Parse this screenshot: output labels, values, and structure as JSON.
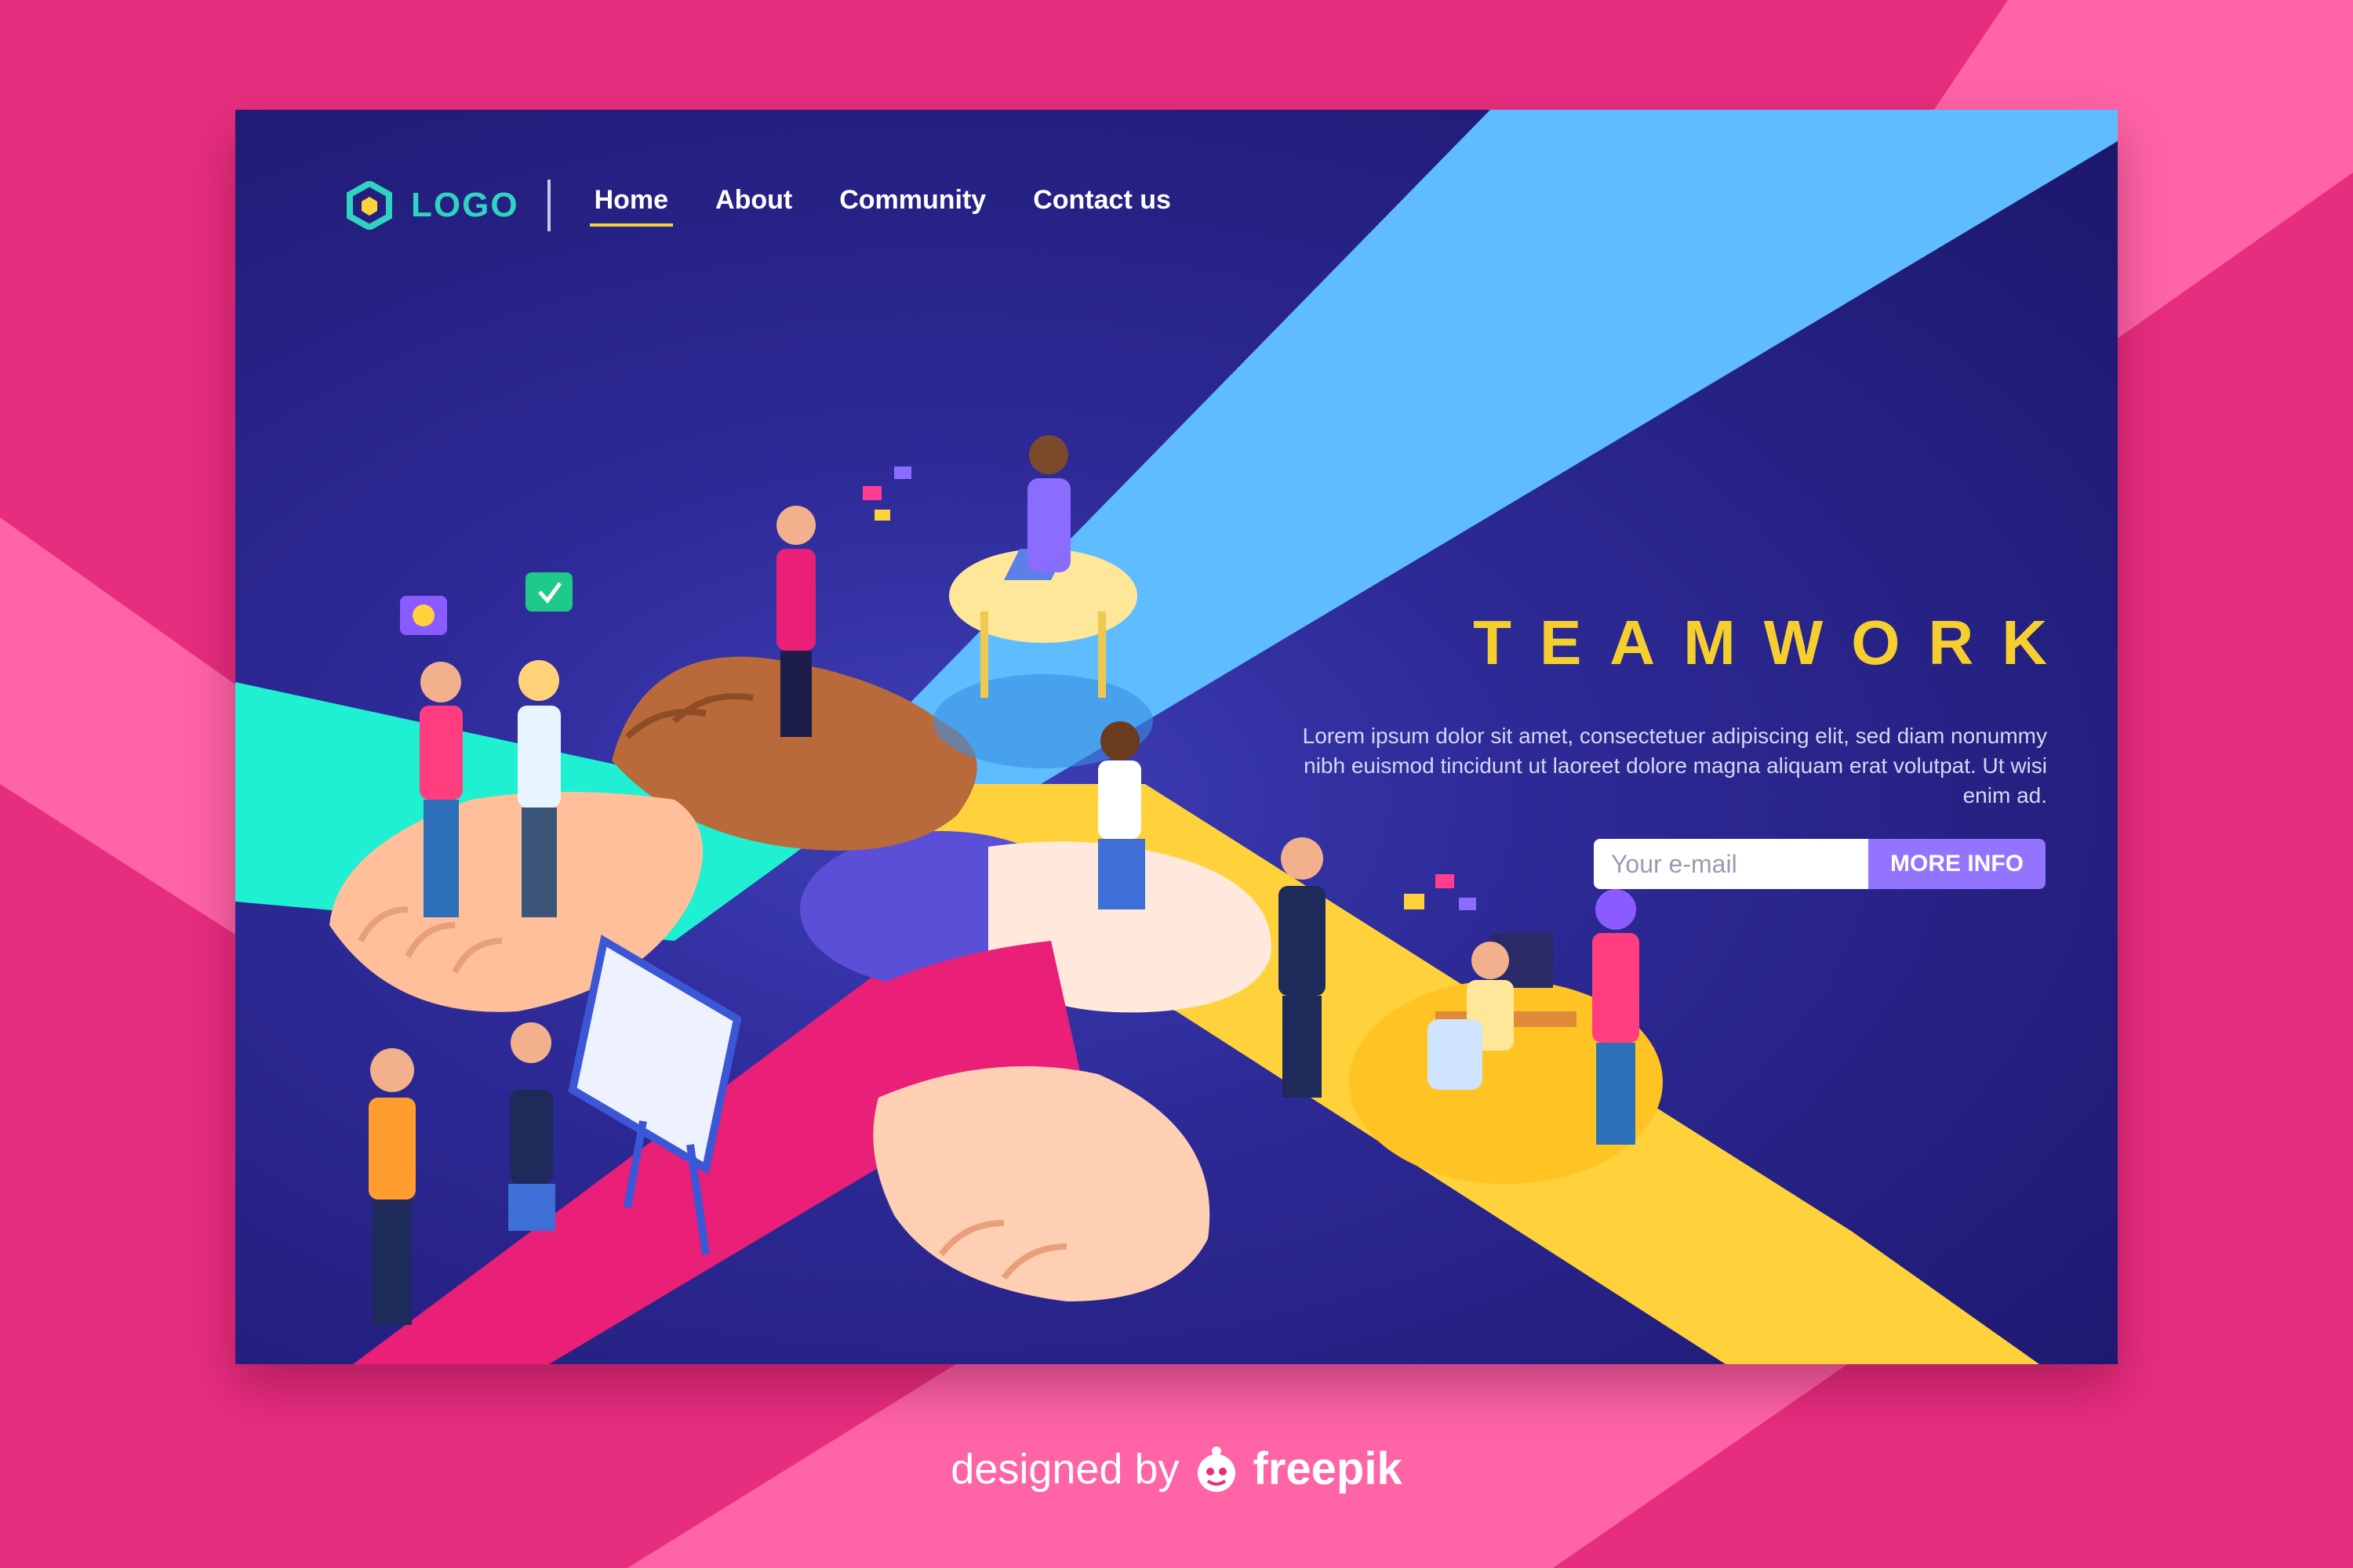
{
  "nav": {
    "logo_label": "LOGO",
    "links": [
      {
        "label": "Home",
        "active": true
      },
      {
        "label": "About",
        "active": false
      },
      {
        "label": "Community",
        "active": false
      },
      {
        "label": "Contact us",
        "active": false
      }
    ]
  },
  "hero": {
    "title": "TEAMWORK",
    "description": "Lorem ipsum dolor sit amet, consectetuer adipiscing elit, sed diam nonummy nibh euismod tincidunt ut laoreet dolore magna aliquam erat volutpat. Ut wisi enim ad."
  },
  "subscribe": {
    "email_placeholder": "Your e-mail",
    "button_label": "MORE INFO"
  },
  "footer": {
    "credit_text": "designed by",
    "brand": "freepik"
  },
  "colors": {
    "background_pink": "#e72d7e",
    "stripe_pink": "#ff64a6",
    "card_navy": "#1c166a",
    "logo_teal": "#2fd3c0",
    "title_yellow": "#f6cf2e",
    "button_purple": "#9274ff",
    "band_blue": "#5ebcff",
    "band_teal": "#1ef0d1",
    "band_yellow": "#ffd23b",
    "band_pink": "#e91f78"
  },
  "icons": [
    "hexagon-logo-icon",
    "smiley-bubble-icon",
    "check-bubble-icon",
    "freepik-mascot-icon"
  ]
}
